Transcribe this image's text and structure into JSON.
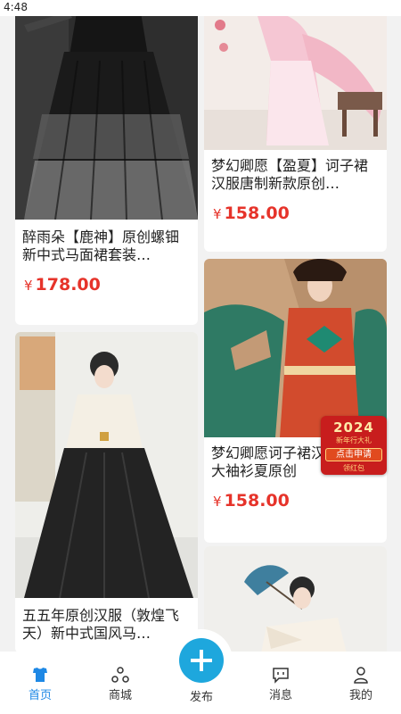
{
  "status": {
    "time": "4:48"
  },
  "products": [
    {
      "title": "醉雨朵【鹿神】原创螺钿新中式马面裙套装…",
      "price_symbol": "¥",
      "price": "178.00"
    },
    {
      "title": "梦幻卿愿【盈夏】诃子裙汉服唐制新款原创…",
      "price_symbol": "¥",
      "price": "158.00"
    },
    {
      "title": "五五年原创汉服（敦煌飞天）新中式国风马…",
      "price_symbol": "",
      "price": ""
    },
    {
      "title": "梦幻卿愿诃子裙汉服唐制大袖衫夏原创",
      "price_symbol": "¥",
      "price": "158.00"
    },
    {
      "title": "",
      "price_symbol": "",
      "price": ""
    }
  ],
  "promo": {
    "year": "2024",
    "subtitle": "新年行大礼",
    "cta": "点击申请",
    "cta2": "领红包"
  },
  "tabbar": {
    "home": "首页",
    "mall": "商城",
    "publish": "发布",
    "messages": "消息",
    "mine": "我的"
  },
  "colors": {
    "accent": "#1e88e5",
    "price": "#e6332a",
    "fab": "#1ea7dd"
  },
  "icons": [
    "home-icon",
    "mall-icon",
    "plus-icon",
    "message-icon",
    "profile-icon"
  ]
}
